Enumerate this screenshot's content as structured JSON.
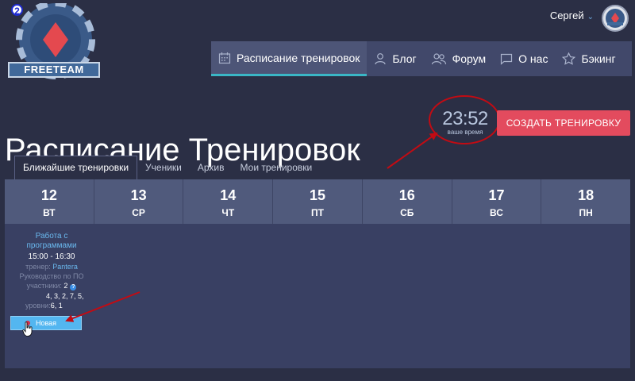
{
  "logo": {
    "badge_number": "2",
    "text": "FREETEAM"
  },
  "user": {
    "name": "Сергей"
  },
  "nav": {
    "items": [
      {
        "label": "Расписание тренировок",
        "icon": "calendar-icon",
        "active": true
      },
      {
        "label": "Блог",
        "icon": "user-icon",
        "active": false
      },
      {
        "label": "Форум",
        "icon": "users-icon",
        "active": false
      },
      {
        "label": "О нас",
        "icon": "message-icon",
        "active": false
      },
      {
        "label": "Бэкинг",
        "icon": "star-icon",
        "active": false
      }
    ]
  },
  "page": {
    "title": "Расписание Тренировок",
    "clock_time": "23:52",
    "clock_label": "ваше время",
    "create_button": "СОЗДАТЬ ТРЕНИРОВКУ"
  },
  "tabs": [
    {
      "label": "Ближайшие тренировки",
      "active": true
    },
    {
      "label": "Ученики",
      "active": false
    },
    {
      "label": "Архив",
      "active": false
    },
    {
      "label": "Мои тренировки",
      "active": false
    }
  ],
  "days": [
    {
      "num": "12",
      "dow": "ВТ"
    },
    {
      "num": "13",
      "dow": "СР"
    },
    {
      "num": "14",
      "dow": "ЧТ"
    },
    {
      "num": "15",
      "dow": "ПТ"
    },
    {
      "num": "16",
      "dow": "СБ"
    },
    {
      "num": "17",
      "dow": "ВС"
    },
    {
      "num": "18",
      "dow": "ПН"
    }
  ],
  "event": {
    "name_line1": "Работа с",
    "name_line2": "программами",
    "time": "15:00 - 16:30",
    "coach_label": "тренер:",
    "coach_name": "Pantera",
    "subtitle": "Руководство по ПО",
    "participants_label": "участники:",
    "participants_value": "2",
    "levels_line1": "4, 3, 2, 7, 5,",
    "levels_label": "уровни:",
    "levels_line2": "6, 1",
    "badge": "Новая"
  },
  "colors": {
    "background": "#2b2f45",
    "nav_bg": "#41486a",
    "accent_teal": "#3ab7c6",
    "create_button": "#e34b5e",
    "link_blue": "#6ab8ee",
    "new_button": "#53b6f0",
    "annotation_red": "#c20b13"
  }
}
